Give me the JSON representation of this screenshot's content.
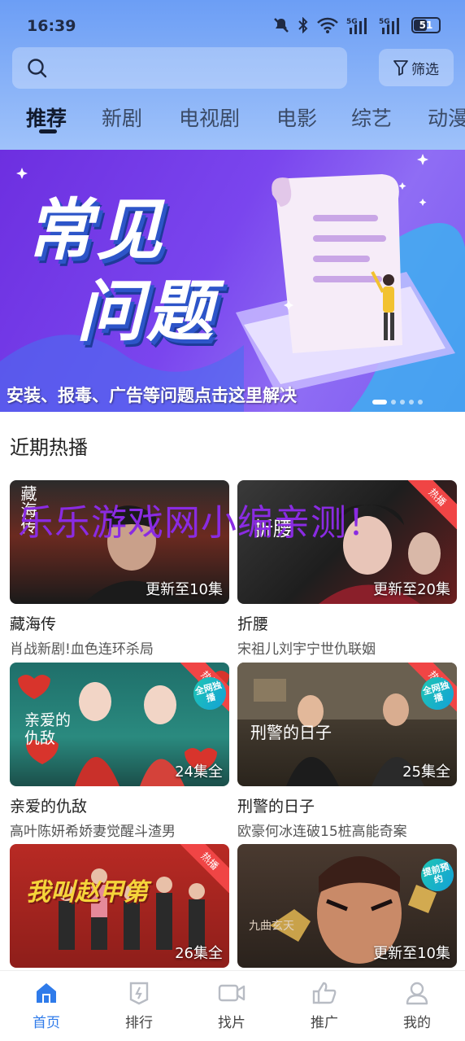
{
  "status": {
    "time": "16:39",
    "battery": "51",
    "net1": "5G",
    "net2": "5G"
  },
  "search": {
    "filter_label": "筛选"
  },
  "tabs": [
    "推荐",
    "新剧",
    "电视剧",
    "电影",
    "综艺",
    "动漫"
  ],
  "banner": {
    "title_line1": "常见",
    "title_line2": "问题",
    "caption": "安装、报毒、广告等问题点击这里解决"
  },
  "section": {
    "title": "近期热播"
  },
  "watermark": "乐乐游戏网小编亲测！",
  "cards": [
    {
      "title": "藏海传",
      "subtitle": "肖战新剧!血色连环杀局",
      "badge": "更新至10集",
      "poster_text": "藏海传",
      "hot": ""
    },
    {
      "title": "折腰",
      "subtitle": "宋祖儿刘宇宁世仇联姻",
      "badge": "更新至20集",
      "poster_text": "折腰",
      "hot": "热播"
    },
    {
      "title": "亲爱的仇敌",
      "subtitle": "高叶陈妍希娇妻觉醒斗渣男",
      "badge": "24集全",
      "poster_text": "亲爱的仇敌",
      "hot": "热播",
      "extra": "全网独播"
    },
    {
      "title": "刑警的日子",
      "subtitle": "欧豪何冰连破15桩高能奇案",
      "badge": "25集全",
      "poster_text": "刑警的日子",
      "hot": "热播",
      "extra": "全网独播"
    },
    {
      "title": "",
      "subtitle": "",
      "badge": "26集全",
      "poster_text": "我叫赵甲第",
      "hot": "热播"
    },
    {
      "title": "",
      "subtitle": "",
      "badge": "更新至10集",
      "poster_text": "九曲玄天",
      "hot": "",
      "extra": "提前预约"
    }
  ],
  "nav": [
    {
      "label": "首页",
      "icon": "home-icon"
    },
    {
      "label": "排行",
      "icon": "ranking-icon"
    },
    {
      "label": "找片",
      "icon": "video-camera-icon"
    },
    {
      "label": "推广",
      "icon": "thumbs-up-icon"
    },
    {
      "label": "我的",
      "icon": "user-icon"
    }
  ],
  "colors": {
    "accent": "#2f7bea",
    "hot": "#f04545",
    "banner": "#6d2fe0"
  }
}
